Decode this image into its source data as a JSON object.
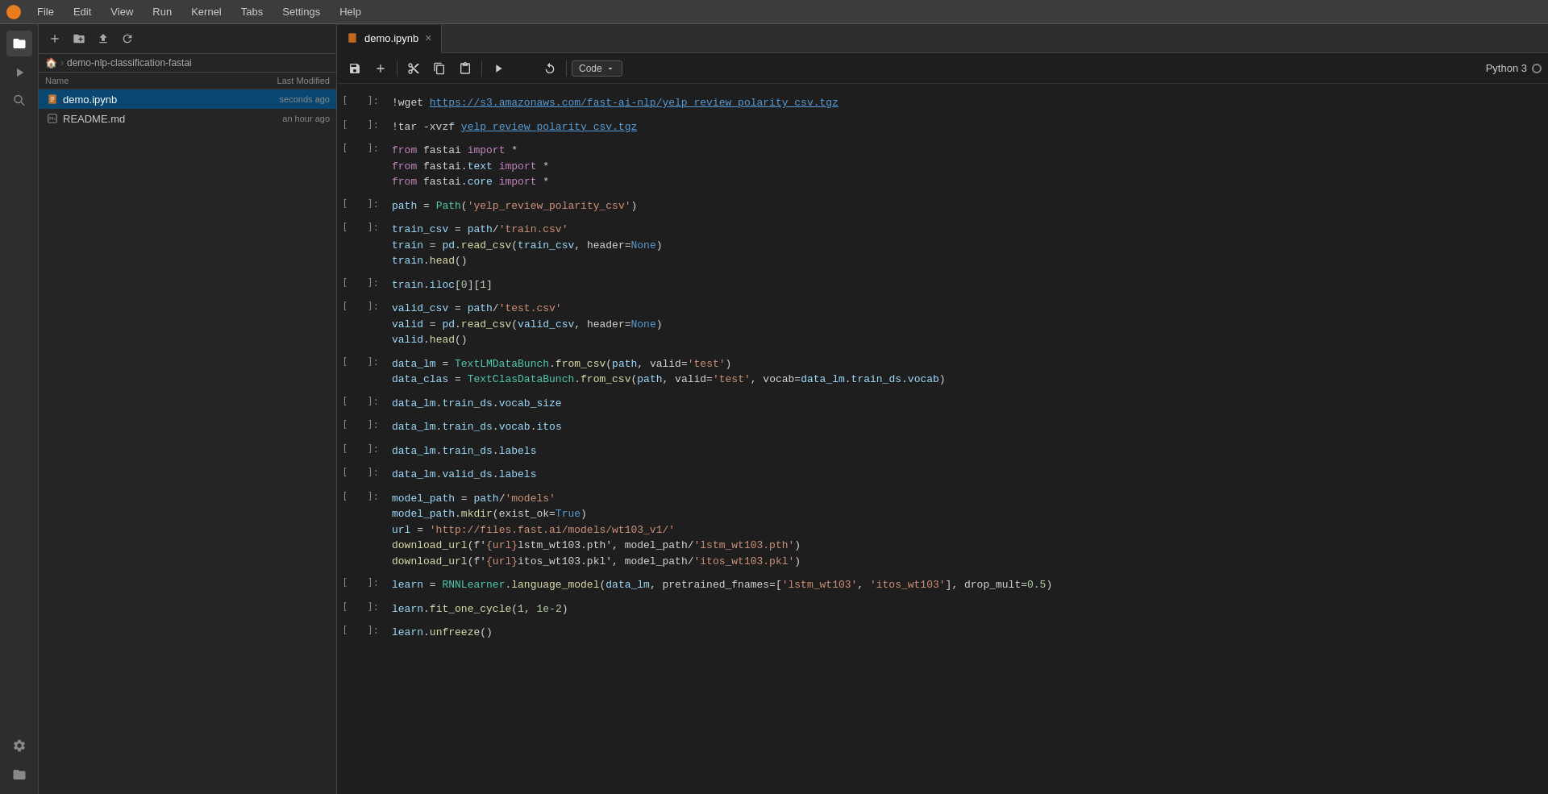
{
  "menuBar": {
    "items": [
      "File",
      "Edit",
      "View",
      "Run",
      "Kernel",
      "Tabs",
      "Settings",
      "Help"
    ]
  },
  "sidebar": {
    "breadcrumb": [
      "demo-nlp-classification-fastai"
    ],
    "header": {
      "nameCol": "Name",
      "modifiedCol": "Last Modified"
    },
    "files": [
      {
        "name": "demo.ipynb",
        "modified": "seconds ago",
        "type": "notebook",
        "active": true
      },
      {
        "name": "README.md",
        "modified": "an hour ago",
        "type": "markdown",
        "active": false
      }
    ]
  },
  "notebook": {
    "tabName": "demo.ipynb",
    "kernelName": "Python 3",
    "cellTypeLabel": "Code",
    "cells": [
      {
        "number": "",
        "lines": [
          "!wget https://s3.amazonaws.com/fast-ai-nlp/yelp_review_polarity_csv.tgz"
        ]
      },
      {
        "number": "",
        "lines": [
          "!tar -xvzf yelp_review_polarity_csv.tgz"
        ]
      },
      {
        "number": "",
        "lines": [
          "from fastai import *",
          "from fastai.text import *",
          "from fastai.core import *"
        ]
      },
      {
        "number": "",
        "lines": [
          "path = Path('yelp_review_polarity_csv')"
        ]
      },
      {
        "number": "",
        "lines": [
          "train_csv = path/'train.csv'",
          "train = pd.read_csv(train_csv, header=None)",
          "train.head()"
        ]
      },
      {
        "number": "",
        "lines": [
          "train.iloc[0][1]"
        ]
      },
      {
        "number": "",
        "lines": [
          "valid_csv = path/'test.csv'",
          "valid = pd.read_csv(valid_csv, header=None)",
          "valid.head()"
        ]
      },
      {
        "number": "",
        "lines": [
          "data_lm = TextLMDataBunch.from_csv(path, valid='test')",
          "data_clas = TextClasDataBunch.from_csv(path, valid='test', vocab=data_lm.train_ds.vocab)"
        ]
      },
      {
        "number": "",
        "lines": [
          "data_lm.train_ds.vocab_size"
        ]
      },
      {
        "number": "",
        "lines": [
          "data_lm.train_ds.vocab.itos"
        ]
      },
      {
        "number": "",
        "lines": [
          "data_lm.train_ds.labels"
        ]
      },
      {
        "number": "",
        "lines": [
          "data_lm.valid_ds.labels"
        ]
      },
      {
        "number": "",
        "lines": [
          "model_path = path/'models'",
          "model_path.mkdir(exist_ok=True)",
          "url = 'http://files.fast.ai/models/wt103_v1/'",
          "download_url(f'{url}lstm_wt103.pth', model_path/'lstm_wt103.pth')",
          "download_url(f'{url}itos_wt103.pkl', model_path/'itos_wt103.pkl')"
        ]
      },
      {
        "number": "",
        "lines": [
          "learn = RNNLearner.language_model(data_lm, pretrained_fnames=['lstm_wt103', 'itos_wt103'], drop_mult=0.5)"
        ]
      },
      {
        "number": "",
        "lines": [
          "learn.fit_one_cycle(1, 1e-2)"
        ]
      },
      {
        "number": "",
        "lines": [
          "learn.unfreeze()"
        ]
      }
    ]
  }
}
